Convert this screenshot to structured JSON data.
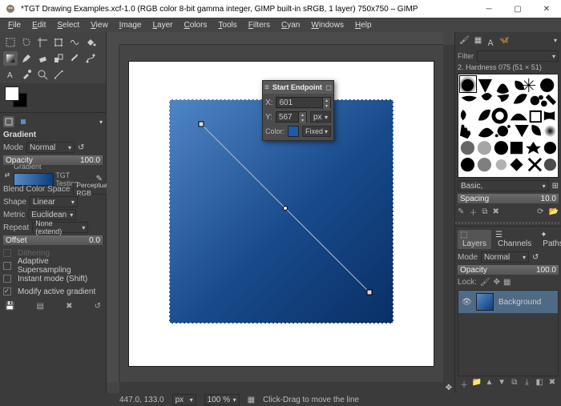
{
  "app": {
    "title": "*TGT Drawing Examples.xcf-1.0 (RGB color 8-bit gamma integer, GIMP built-in sRGB, 1 layer) 750x750 – GIMP"
  },
  "menu": [
    "File",
    "Edit",
    "Select",
    "View",
    "Image",
    "Layer",
    "Colors",
    "Tools",
    "Filters",
    "Cyan",
    "Windows",
    "Help"
  ],
  "tool_options": {
    "title": "Gradient",
    "mode_label": "Mode",
    "mode_value": "Normal",
    "opacity_label": "Opacity",
    "opacity_value": "100.0",
    "gradient_label": "Gradient",
    "gradient_name": "TGT Testing",
    "blend_label": "Blend Color Space",
    "blend_value": "Perceptual RGB",
    "shape_label": "Shape",
    "shape_value": "Linear",
    "metric_label": "Metric",
    "metric_value": "Euclidean",
    "repeat_label": "Repeat",
    "repeat_value": "None (extend)",
    "offset_label": "Offset",
    "offset_value": "0.0",
    "dithering": "Dithering",
    "adaptive": "Adaptive Supersampling",
    "instant": "Instant mode  (Shift)",
    "modify": "Modify active gradient"
  },
  "float": {
    "title": "Start Endpoint",
    "x_label": "X:",
    "x_value": "601",
    "y_label": "Y:",
    "y_value": "567",
    "unit": "px",
    "color_label": "Color:",
    "color_mode": "Fixed"
  },
  "right": {
    "filter_label": "Filter",
    "brush_line": "2. Hardness 075 (51 × 51)",
    "brush_preset": "Basic,",
    "spacing_label": "Spacing",
    "spacing_value": "10.0",
    "layers_tab": "Layers",
    "channels_tab": "Channels",
    "paths_tab": "Paths",
    "mode_label": "Mode",
    "mode_value": "Normal",
    "opacity_label": "Opacity",
    "opacity_value": "100.0",
    "lock_label": "Lock:",
    "layer_name": "Background"
  },
  "status": {
    "coords": "447.0, 133.0",
    "unit": "px",
    "zoom": "100 %",
    "hint": "Click-Drag to move the line"
  }
}
